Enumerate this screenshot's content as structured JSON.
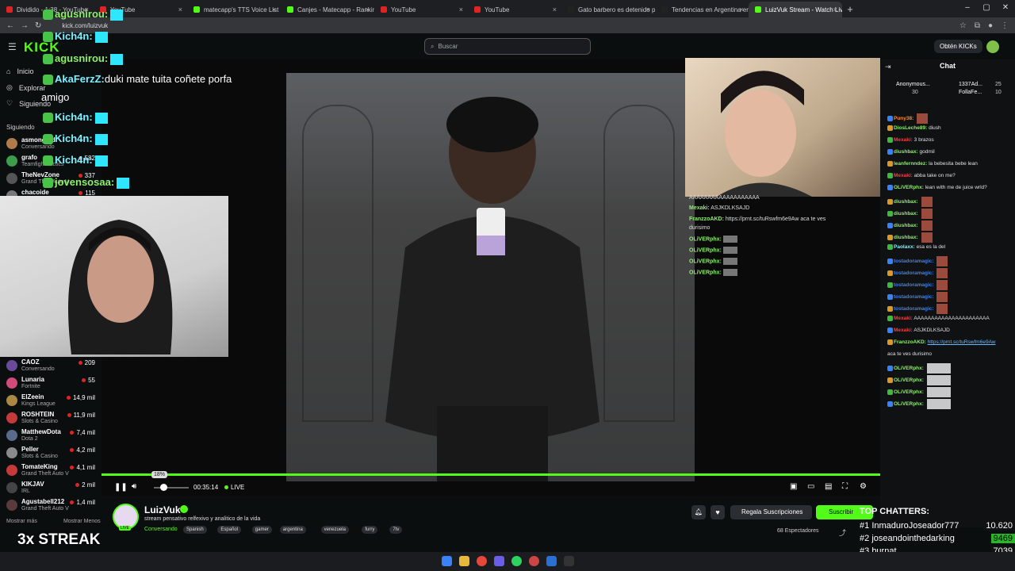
{
  "browser": {
    "tabs": [
      {
        "title": "Dividido - 1:38 - YouTube",
        "color": "#e02424"
      },
      {
        "title": "YouTube",
        "color": "#e02424"
      },
      {
        "title": "matecapp's TTS Voice List | Kick",
        "color": "#53fc18"
      },
      {
        "title": "Canjes - Matecapp - Ranking y",
        "color": "#53fc18"
      },
      {
        "title": "YouTube",
        "color": "#e02424"
      },
      {
        "title": "YouTube",
        "color": "#e02424"
      },
      {
        "title": "Gato barbero es detenido por",
        "color": "#222222"
      },
      {
        "title": "Tendencias en Argentina en X",
        "color": "#222222"
      },
      {
        "title": "LuizVuk Stream - Watch Live",
        "color": "#53fc18"
      }
    ],
    "url": "kick.com/luizvuk"
  },
  "header": {
    "logo": "KICK",
    "search_placeholder": "Buscar",
    "get_kicks": "Obtén KICKs"
  },
  "sidebar": {
    "nav": [
      "Inicio",
      "Explorar",
      "Siguiendo"
    ],
    "following_title": "Siguiendo",
    "channels_top": [
      {
        "name": "asmongold",
        "game": "Conversando",
        "color": "#b07a4a"
      },
      {
        "name": "grafo",
        "game": "Teamfight Tactics",
        "viewers": "582",
        "color": "#3a9e4a"
      },
      {
        "name": "TheNevZone",
        "game": "Grand Theft Auto V",
        "viewers": "337",
        "color": "#555"
      },
      {
        "name": "chacoide",
        "game": "",
        "viewers": "115",
        "color": "#777"
      }
    ],
    "channels_bottom": [
      {
        "name": "CAOZ",
        "game": "Conversando",
        "viewers": "209",
        "color": "#6a4a9a"
      },
      {
        "name": "Lunaria",
        "game": "Fortnite",
        "viewers": "55",
        "color": "#d04a7a"
      },
      {
        "name": "ElZeein",
        "game": "Kings League",
        "viewers": "14,9 mil",
        "color": "#aa8844"
      },
      {
        "name": "ROSHTEIN",
        "game": "Slots & Casino",
        "viewers": "11,9 mil",
        "color": "#c43a3a"
      },
      {
        "name": "MatthewDota",
        "game": "Dota 2",
        "viewers": "7,4 mil",
        "color": "#5a6a8a"
      },
      {
        "name": "Peller",
        "game": "Slots & Casino",
        "viewers": "4,2 mil",
        "color": "#8a8a8a"
      },
      {
        "name": "TomateKing",
        "game": "Grand Theft Auto V",
        "viewers": "4,1 mil",
        "color": "#c43a3a"
      },
      {
        "name": "KIKJAV",
        "game": "IRL",
        "viewers": "2 mil",
        "color": "#444"
      },
      {
        "name": "Agustabell212",
        "game": "Grand Theft Auto V",
        "viewers": "1,4 mil",
        "color": "#5a3a3a"
      }
    ],
    "show_more": "Mostrar más",
    "show_less": "Mostrar Menos"
  },
  "overlay_chat": [
    {
      "user": "agusnirou:",
      "msg": ""
    },
    {
      "user": "Kich4n:",
      "msg": ""
    },
    {
      "user": "agusnirou:",
      "msg": ""
    },
    {
      "user": "AkaFerzZ:",
      "msg": "duki mate tuita coñete porfa"
    },
    {
      "user": "",
      "msg": "amigo"
    },
    {
      "user": "Kich4n:",
      "msg": ""
    },
    {
      "user": "Kich4n:",
      "msg": ""
    },
    {
      "user": "Kich4n:",
      "msg": ""
    },
    {
      "user": "jovensosaa:",
      "msg": ""
    }
  ],
  "stream_chat": [
    {
      "user": "",
      "msg": "AAAAAAAAAAAAAAAAAAA"
    },
    {
      "user": "Mexaki:",
      "msg": "ASJKDLKSAJD"
    },
    {
      "user": "FranzzoAKD:",
      "msg": "https://prnt.sc/tuRswfm6e9Aw aca te ves"
    },
    {
      "user": "",
      "msg": "durisimo"
    },
    {
      "user": "OLiVERphx:",
      "msg": ""
    },
    {
      "user": "OLiVERphx:",
      "msg": ""
    },
    {
      "user": "OLiVERphx:",
      "msg": ""
    },
    {
      "user": "OLiVERphx:",
      "msg": ""
    }
  ],
  "player": {
    "volume_tooltip": "18%",
    "volume": 0.18,
    "time": "00:35:14",
    "live": "LIVE",
    "progress": 1.0
  },
  "chat": {
    "title": "Chat",
    "pinned": [
      {
        "name": "Anonymous...",
        "count": "30"
      },
      {
        "name": "1337Ad...",
        "count": "25"
      },
      {
        "name": "FollaFe...",
        "count": "10"
      }
    ],
    "messages": [
      {
        "user": "Puny38:",
        "msg": "",
        "ucolor": "#ff8a2a"
      },
      {
        "user": "DiosLeche89:",
        "msg": "diush",
        "ucolor": "#8ef06d"
      },
      {
        "user": "Mexaki:",
        "msg": "3 brazos",
        "ucolor": "#ff3b3b"
      },
      {
        "user": "diushbax:",
        "msg": "godmil",
        "ucolor": "#8ef06d"
      },
      {
        "user": "leanfernndez:",
        "msg": "la bebesita bebe lean",
        "ucolor": "#8ef06d"
      },
      {
        "user": "Mexaki:",
        "msg": "abba take on me?",
        "ucolor": "#ff3b3b"
      },
      {
        "user": "OLiVERphx:",
        "msg": "lean with me de juice wrld?",
        "ucolor": "#8ef06d"
      },
      {
        "user": "diushbax:",
        "msg": "",
        "ucolor": "#8ef06d"
      },
      {
        "user": "diushbax:",
        "msg": "",
        "ucolor": "#8ef06d"
      },
      {
        "user": "diushbax:",
        "msg": "",
        "ucolor": "#8ef06d"
      },
      {
        "user": "diushbax:",
        "msg": "",
        "ucolor": "#8ef06d"
      },
      {
        "user": "Paolaxx:",
        "msg": "esa es la del",
        "ucolor": "#7ef0ff"
      },
      {
        "user": "tostadoramagic:",
        "msg": "",
        "ucolor": "#3a82f7"
      },
      {
        "user": "tostadoramagic:",
        "msg": "",
        "ucolor": "#3a82f7"
      },
      {
        "user": "tostadoramagic:",
        "msg": "",
        "ucolor": "#3a82f7"
      },
      {
        "user": "tostadoramagic:",
        "msg": "",
        "ucolor": "#3a82f7"
      },
      {
        "user": "tostadoramagic:",
        "msg": "",
        "ucolor": "#3a82f7"
      },
      {
        "user": "Mexaki:",
        "msg": "AAAAAAAAAAAAAAAAAAAAAA",
        "ucolor": "#ff3b3b"
      },
      {
        "user": "Mexaki:",
        "msg": "ASJKDLKSAJD",
        "ucolor": "#ff3b3b"
      },
      {
        "user": "FranzzoAKD:",
        "msg": "https://prnt.sc/tuRswfm6e9Aw",
        "ucolor": "#8ef06d"
      },
      {
        "user": "",
        "msg": "aca te ves durisimo",
        "ucolor": "#8ef06d"
      },
      {
        "user": "OLiVERphx:",
        "msg": "",
        "ucolor": "#8ef06d"
      },
      {
        "user": "OLiVERphx:",
        "msg": "",
        "ucolor": "#8ef06d"
      },
      {
        "user": "OLiVERphx:",
        "msg": "",
        "ucolor": "#8ef06d"
      },
      {
        "user": "OLiVERphx:",
        "msg": "",
        "ucolor": "#8ef06d"
      }
    ]
  },
  "streamer": {
    "name": "LuizVuk",
    "title": "stream pensativo relfexivo y analitico de la vida",
    "category": "Conversando",
    "tags": [
      "Spanish",
      "Español",
      "gamer",
      "argentina",
      "venezuela",
      "furry",
      "7tv"
    ],
    "live_badge": "LIVE",
    "viewers": "68 Espectadores",
    "gift_label": "Regala Suscripciones",
    "sub_label": "Suscribir"
  },
  "streak": "3x STREAK",
  "top_chatters": {
    "title": "TOP CHATTERS:",
    "rows": [
      {
        "rank": "#1",
        "name": "InmaduroJoseador777",
        "score": "10.620"
      },
      {
        "rank": "#2",
        "name": "joseandointhedarking",
        "score": "9469"
      },
      {
        "rank": "#3",
        "name": "burnat",
        "score": "7039"
      }
    ]
  }
}
